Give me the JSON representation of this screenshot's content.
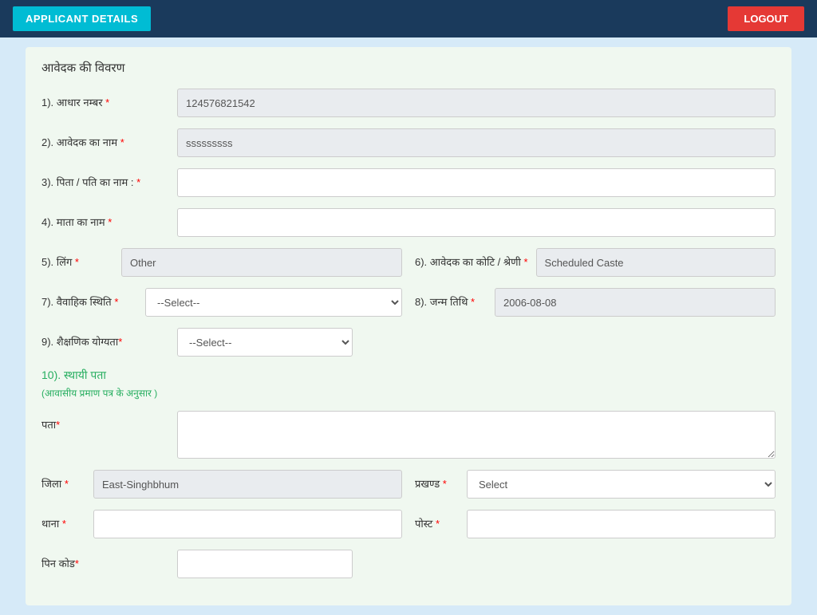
{
  "topbar": {
    "applicant_btn": "APPLICANT DETAILS",
    "logout_btn": "LOGOUT"
  },
  "form": {
    "section_title": "आवेदक की विवरण",
    "fields": {
      "aadhar_label": "1). आधार नम्बर",
      "aadhar_value": "124576821542",
      "name_label": "2). आवेदक का नाम",
      "name_value": "sssssssss",
      "father_label": "3). पिता / पति का नाम :",
      "father_value": "",
      "mother_label": "4). माता का नाम",
      "mother_value": "",
      "gender_label": "5). लिंग",
      "gender_value": "Other",
      "caste_label": "6). आवेदक का कोटि / श्रेणी",
      "caste_value": "Scheduled Caste",
      "marital_label": "7). वैवाहिक स्थिति",
      "marital_placeholder": "--Select--",
      "dob_label": "8). जन्म तिथि",
      "dob_value": "2006-08-08",
      "education_label": "9). शैक्षणिक योग्यता",
      "education_placeholder": "--Select--"
    },
    "address": {
      "title": "10). स्थायी पता",
      "subtitle": "(आवासीय प्रमाण पत्र के अनुसार )",
      "address_label": "पता",
      "address_value": "",
      "district_label": "जिला",
      "district_value": "East-Singhbhum",
      "block_label": "प्रखण्ड",
      "block_placeholder": "Select",
      "thana_label": "थाना",
      "thana_value": "",
      "post_label": "पोस्ट",
      "post_value": "",
      "pincode_label": "पिन कोड"
    }
  }
}
